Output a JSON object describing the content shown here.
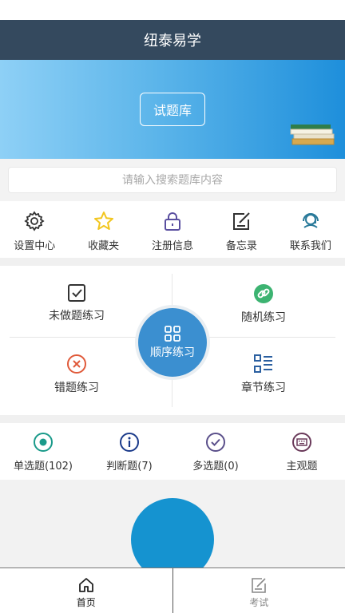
{
  "app": {
    "title": "纽泰易学"
  },
  "banner": {
    "button_label": "试题库"
  },
  "search": {
    "placeholder": "请输入搜索题库内容"
  },
  "quick_menu": [
    {
      "label": "设置中心",
      "icon": "gear-icon",
      "color": "#333333"
    },
    {
      "label": "收藏夹",
      "icon": "star-icon",
      "color": "#f2c61f"
    },
    {
      "label": "注册信息",
      "icon": "lock-icon",
      "color": "#5a4fa0"
    },
    {
      "label": "备忘录",
      "icon": "note-edit-icon",
      "color": "#333333"
    },
    {
      "label": "联系我们",
      "icon": "headset-icon",
      "color": "#2a7a9a"
    }
  ],
  "practice": {
    "unanswered": {
      "label": "未做题练习",
      "icon": "checkbox-icon",
      "color": "#333333"
    },
    "random": {
      "label": "随机练习",
      "icon": "link-icon",
      "color": "#3cb371"
    },
    "sequential": {
      "label": "顺序练习",
      "icon": "grid-icon",
      "color": "#3b8fd0"
    },
    "wrong": {
      "label": "错题练习",
      "icon": "x-circle-icon",
      "color": "#e05a3a"
    },
    "chapter": {
      "label": "章节练习",
      "icon": "list-icon",
      "color": "#2a5fa0"
    }
  },
  "question_types": [
    {
      "label": "单选题(102)",
      "icon": "radio-icon",
      "color": "#1a9a8a"
    },
    {
      "label": "判断题(7)",
      "icon": "info-icon",
      "color": "#1a3a8a"
    },
    {
      "label": "多选题(0)",
      "icon": "check-circle-icon",
      "color": "#5a4f8a"
    },
    {
      "label": "主观题",
      "icon": "keyboard-icon",
      "color": "#6a3a5a"
    }
  ],
  "bottom_nav": [
    {
      "label": "首页",
      "icon": "home-icon",
      "active": true
    },
    {
      "label": "考试",
      "icon": "exam-icon",
      "active": false
    }
  ],
  "colors": {
    "title_bar": "#34495e",
    "accent": "#3b8fd0",
    "circle": "#1593d0"
  }
}
